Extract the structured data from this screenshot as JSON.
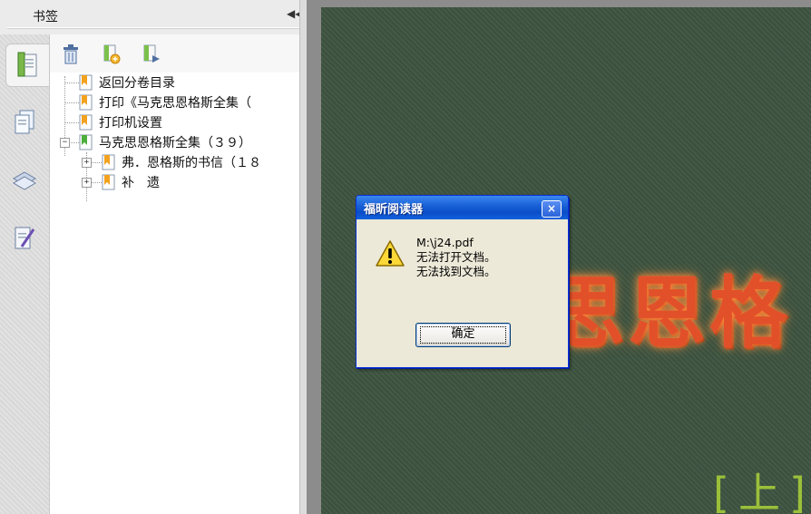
{
  "panel": {
    "title": "书签",
    "collapse_icon": "double-left-arrow",
    "tabs": [
      {
        "name": "bookmarks-tab",
        "icon": "bookmark-page-icon",
        "active": true
      },
      {
        "name": "pages-tab",
        "icon": "pages-icon",
        "active": false
      },
      {
        "name": "layers-tab",
        "icon": "layers-icon",
        "active": false
      },
      {
        "name": "annotations-tab",
        "icon": "annotation-pen-icon",
        "active": false
      }
    ],
    "toolbar": [
      {
        "name": "delete-bookmark",
        "icon": "trash-icon"
      },
      {
        "name": "add-bookmark",
        "icon": "new-bookmark-icon"
      },
      {
        "name": "add-sub-bookmark",
        "icon": "bookmark-arrow-icon"
      }
    ]
  },
  "tree": {
    "items": [
      {
        "label": "返回分卷目录",
        "bookmark_color": "#f2a21f"
      },
      {
        "label": "打印《马克思恩格斯全集（",
        "bookmark_color": "#f2a21f"
      },
      {
        "label": "打印机设置",
        "bookmark_color": "#f2a21f"
      },
      {
        "label": "马克思恩格斯全集（３９）",
        "bookmark_color": "#4caf3a",
        "expander": "−"
      },
      {
        "label": "弗．恩格斯的书信（１８",
        "bookmark_color": "#f2a21f",
        "expander": "+"
      },
      {
        "label": "补　遗",
        "bookmark_color": "#f2a21f",
        "expander": "+"
      }
    ]
  },
  "document": {
    "title_text": "克思恩格",
    "volume_text": "[上]",
    "background_color": "#3d5340",
    "title_color": "#e2502a",
    "volume_color": "#9bbf3a"
  },
  "dialog": {
    "title": "福昕阅读器",
    "close_label": "×",
    "icon": "warning-icon",
    "message_lines": [
      "M:\\j24.pdf",
      "无法打开文档。",
      "无法找到文档。"
    ],
    "ok_label": "确定"
  }
}
